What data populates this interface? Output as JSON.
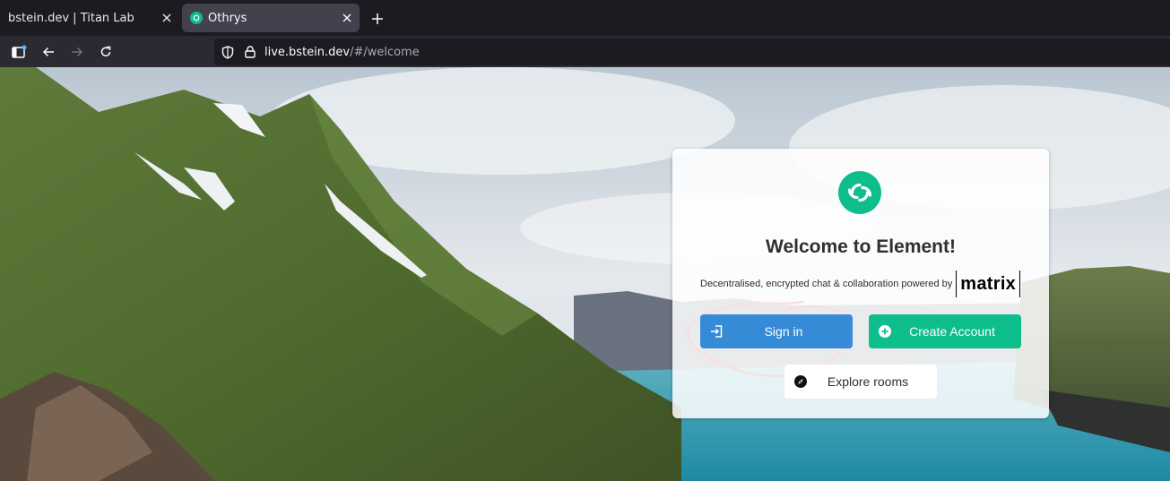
{
  "browser": {
    "tabs": [
      {
        "title": "bstein.dev | Titan Lab",
        "active": false
      },
      {
        "title": "Othrys",
        "active": true
      }
    ],
    "url": {
      "host": "live.bstein.dev",
      "path": "/#/welcome"
    }
  },
  "welcome": {
    "title": "Welcome to Element!",
    "tagline": "Decentralised, encrypted chat & collaboration powered by",
    "matrix_logo": "matrix",
    "buttons": {
      "sign_in": "Sign in",
      "create_account": "Create Account",
      "explore_rooms": "Explore rooms"
    }
  },
  "colors": {
    "sign_in": "#368bd6",
    "create_account": "#0dbd8b",
    "element_brand": "#0dbd8b",
    "annotation": "#e0151d"
  },
  "icons": {
    "sign_in": "sign-in-icon",
    "create_account": "plus-circle-icon",
    "explore_rooms": "compass-icon",
    "logo": "element-logo-icon"
  }
}
